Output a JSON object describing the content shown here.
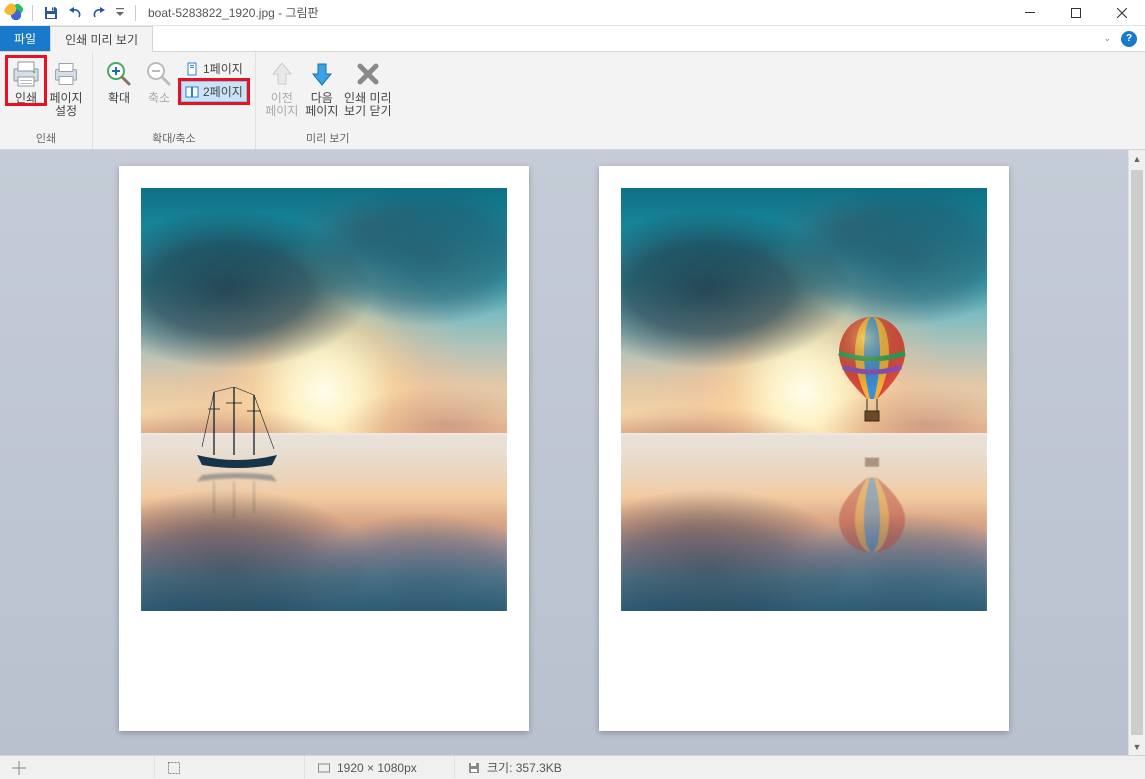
{
  "title": "boat-5283822_1920.jpg - 그림판",
  "tabs": {
    "file": "파일",
    "print_preview": "인쇄 미리 보기"
  },
  "ribbon": {
    "print_group_label": "인쇄",
    "zoom_group_label": "확대/축소",
    "preview_group_label": "미리 보기",
    "print_btn": "인쇄",
    "page_setup_btn": "페이지\n설정",
    "zoom_in_btn": "확대",
    "zoom_out_btn": "축소",
    "one_page": "1페이지",
    "two_page": "2페이지",
    "prev_page": "이전\n페이지",
    "next_page": "다음\n페이지",
    "close_preview": "인쇄 미리\n보기 닫기"
  },
  "status": {
    "dimensions": "1920 × 1080px",
    "size": "크기: 357.3KB"
  },
  "icons": {
    "save": "save-icon",
    "undo": "undo-icon",
    "redo": "redo-icon"
  },
  "highlights": {
    "print_btn": true,
    "two_page_btn": true
  }
}
